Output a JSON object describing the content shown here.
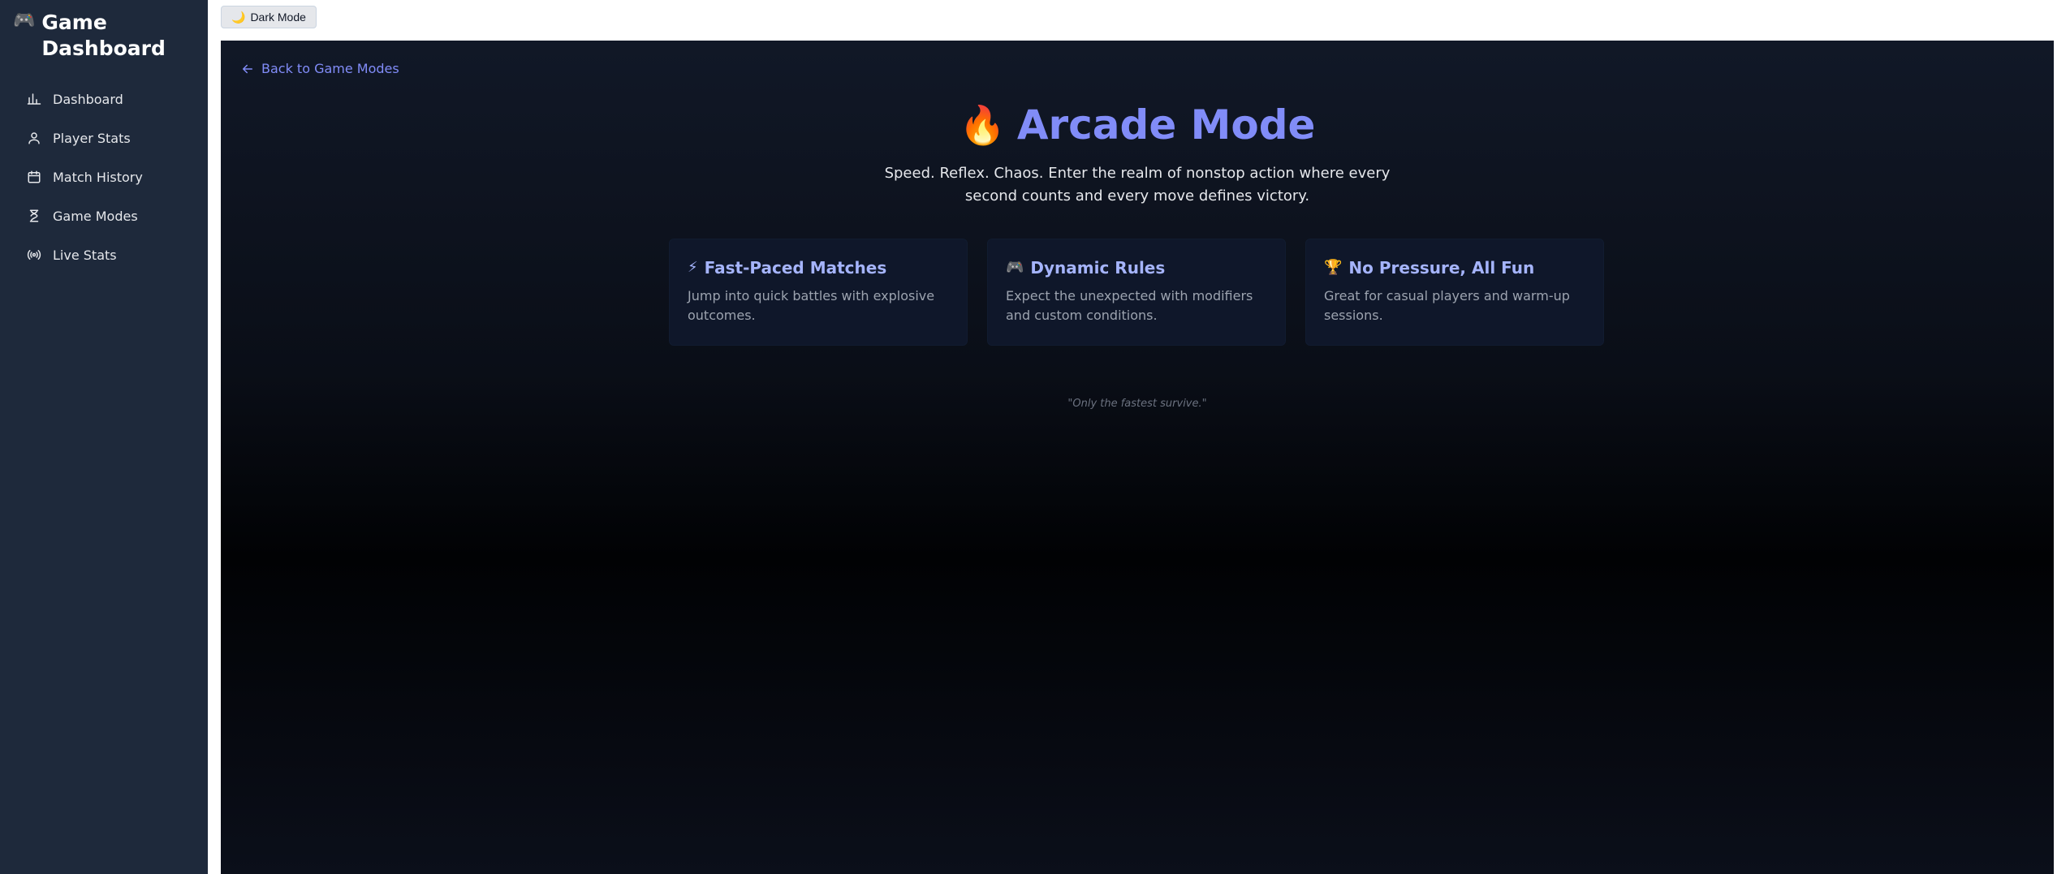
{
  "sidebar": {
    "brand_icon": "game-controller-icon",
    "brand_emoji": "🎮",
    "brand_title": "Game Dashboard",
    "items": [
      {
        "label": "Dashboard",
        "icon": "bar-chart-icon"
      },
      {
        "label": "Player Stats",
        "icon": "user-icon"
      },
      {
        "label": "Match History",
        "icon": "calendar-icon"
      },
      {
        "label": "Game Modes",
        "icon": "hourglass-icon"
      },
      {
        "label": "Live Stats",
        "icon": "broadcast-icon"
      }
    ]
  },
  "toolbar": {
    "mode_toggle_emoji": "🌙",
    "mode_toggle_label": "Dark Mode"
  },
  "page": {
    "back_label": "Back to Game Modes",
    "title_emoji": "🔥",
    "title": "Arcade Mode",
    "subtitle": "Speed. Reflex. Chaos. Enter the realm of nonstop action where every second counts and every move defines victory.",
    "features": [
      {
        "emoji": "⚡",
        "title": "Fast-Paced Matches",
        "desc": "Jump into quick battles with explosive outcomes."
      },
      {
        "emoji": "🎮",
        "title": "Dynamic Rules",
        "desc": "Expect the unexpected with modifiers and custom conditions."
      },
      {
        "emoji": "🏆",
        "title": "No Pressure, All Fun",
        "desc": "Great for casual players and warm-up sessions."
      }
    ],
    "quote": "\"Only the fastest survive.\""
  },
  "colors": {
    "sidebar_bg": "#1e293b",
    "accent": "#818cf8",
    "card_bg": "#0f172a"
  }
}
